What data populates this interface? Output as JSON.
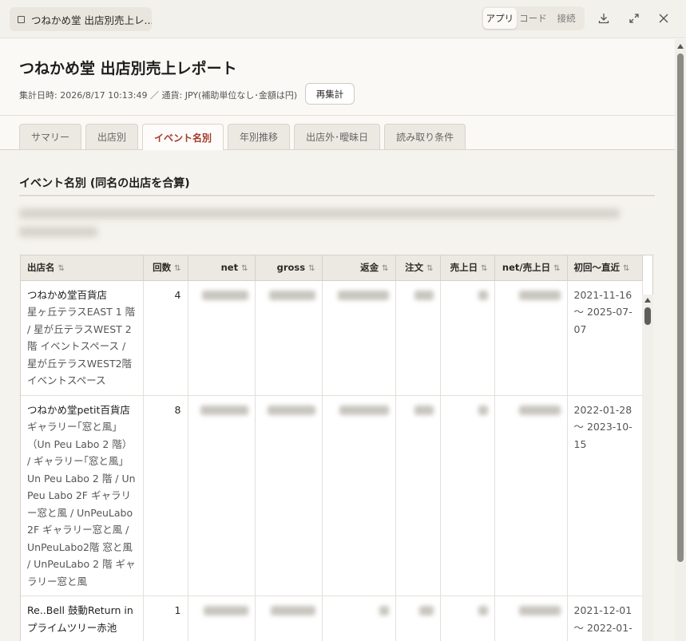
{
  "topbar": {
    "doc_title": "つねかめ堂 出店別売上レ...",
    "view_modes": [
      "アプリ",
      "コード",
      "接続"
    ],
    "active_mode": "アプリ"
  },
  "report": {
    "title": "つねかめ堂 出店別売上レポート",
    "meta": "集計日時: 2026/8/17 10:13:49 ／ 通貨: JPY(補助単位なし･金額は円)",
    "reaggregate_label": "再集計"
  },
  "tabs": [
    "サマリー",
    "出店別",
    "イベント名別",
    "年別推移",
    "出店外･曖昧日",
    "読み取り条件"
  ],
  "active_tab": "イベント名別",
  "section": {
    "heading": "イベント名別 (同名の出店を合算)"
  },
  "table": {
    "columns": [
      "出店名",
      "回数",
      "net",
      "gross",
      "返金",
      "注文",
      "売上日",
      "net/売上日",
      "初回〜直近"
    ],
    "rows": [
      {
        "store": "つねかめ堂百貨店",
        "venues": "星ヶ丘テラスEAST 1 階 / 星が丘テラスWEST 2 階 イベントスペース / 星が丘テラスWEST2階 イベントスペース",
        "count": "4",
        "period": "2021-11-16 〜 2025-07-07"
      },
      {
        "store": "つねかめ堂petit百貨店",
        "venues": "ギャラリー｢窓と風｣（Un Peu Labo 2 階） / ギャラリー｢窓と風｣ Un Peu Labo 2 階 / Un Peu Labo 2F ギャラリー窓と風 / UnPeuLabo 2F ギャラリー窓と風 / UnPeuLabo2階 窓と風 / UnPeuLabo 2 階 ギャラリー窓と風",
        "count": "8",
        "period": "2022-01-28 〜 2023-10-15"
      },
      {
        "store": "Re..Bell 鼓動Return in プライムツリー赤池",
        "venues": "",
        "count": "1",
        "period": "2021-12-01 〜 2022-01-"
      }
    ]
  }
}
